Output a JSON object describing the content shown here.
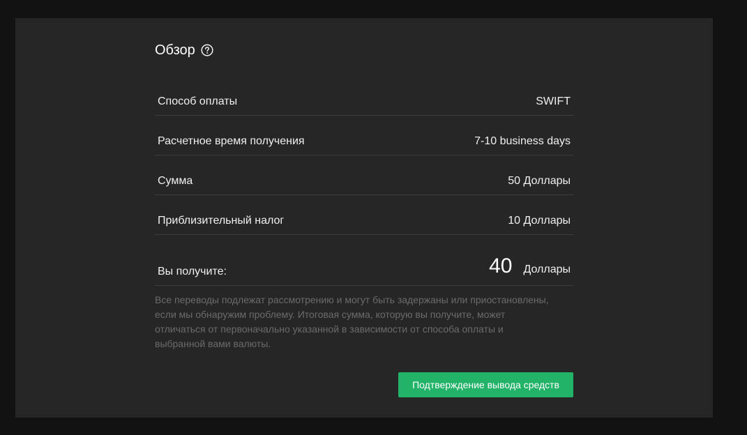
{
  "summary": {
    "title": "Обзор",
    "help_icon": "question-circle-icon"
  },
  "rows": [
    {
      "label": "Способ оплаты",
      "value": "SWIFT"
    },
    {
      "label": "Расчетное время получения",
      "value": "7-10 business days"
    },
    {
      "label": "Сумма",
      "value": "50 Доллары"
    },
    {
      "label": "Приблизительный налог",
      "value": "10 Доллары"
    }
  ],
  "total": {
    "label": "Вы получите:",
    "amount": "40",
    "currency": "Доллары"
  },
  "disclaimer": "Все переводы подлежат рассмотрению и могут быть задержаны или приостановлены, если мы обнаружим проблему. Итоговая сумма, которую вы получите, может отличаться от первоначально указанной в зависимости от способа оплаты и выбранной вами валюты.",
  "actions": {
    "confirm_label": "Подтверждение вывода средств"
  },
  "colors": {
    "background": "#121212",
    "panel": "#262626",
    "accent": "#22b268",
    "divider": "#3d3d3d",
    "muted_text": "#6b6b6b"
  }
}
